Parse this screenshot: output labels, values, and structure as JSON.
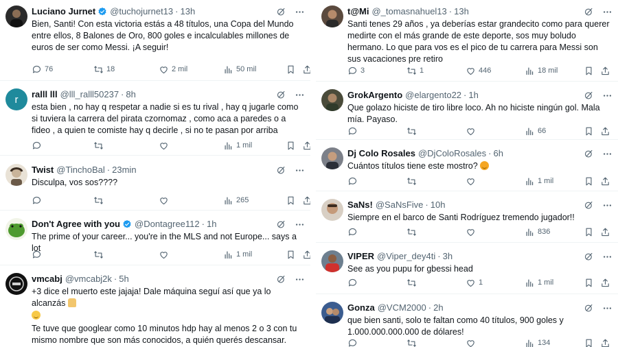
{
  "left": [
    {
      "name": "Luciano Jurnet",
      "verified": true,
      "handle": "@tuchojurnet13",
      "time": "13h",
      "text": "Bien, Santi! Con esta victoria estás a 48 títulos, una Copa del Mundo entre ellos, 8 Balones de Oro, 800 goles e incalculables millones de euros de ser como Messi. ¡A seguir!",
      "replies": "76",
      "retweets": "18",
      "likes": "2 mil",
      "views": "50 mil",
      "avatar_icon": "dark-portrait-avatar"
    },
    {
      "name": "ralll lll",
      "verified": false,
      "handle": "@lll_ralll50237",
      "time": "8h",
      "text": "esta bien , no hay q respetar a nadie si es tu rival , hay q jugarle como si tuviera la carrera del pirata czornomaz , como aca a paredes o a fideo , a quien te comiste hay q decirle , si no te pasan por arriba",
      "replies": "",
      "retweets": "",
      "likes": "",
      "views": "1 mil",
      "avatar_letter": "r"
    },
    {
      "name": "Twist",
      "verified": false,
      "handle": "@TinchoBal",
      "time": "23min",
      "text": "Disculpa, vos sos????",
      "replies": "",
      "retweets": "",
      "likes": "",
      "views": "265",
      "avatar_icon": "sketch-avatar"
    },
    {
      "name": "Don't Agree with you",
      "verified": true,
      "handle": "@Dontagree112",
      "time": "1h",
      "text": "The prime of your career... you're in the MLS and not Europe... says a lot",
      "replies": "",
      "retweets": "",
      "likes": "",
      "views": "1 mil",
      "avatar_icon": "green-frog-avatar"
    },
    {
      "name": "vmcabj",
      "verified": false,
      "handle": "@vmcabj2k",
      "time": "5h",
      "text_line1": "+3 dice el muerto este jajaja! Dale máquina seguí así que ya lo alcanzás",
      "text_line2": "Te tuve que googlear como 10 minutos hdp hay al menos 2 o 3 con tu mismo nombre que son más conocidos, a quién querés descansar.",
      "avatar_icon": "club-crest-avatar"
    }
  ],
  "right": [
    {
      "name": "t@Mi",
      "verified": false,
      "handle": "@_tomasnahuel13",
      "time": "13h",
      "text": "Santi tenes 29 años , ya deberías estar grandecito como para querer medirte con el más grande de este deporte, sos muy boludo hermano. Lo que para vos es el pico de tu carrera para Messi son sus vacaciones pre retiro",
      "replies": "3",
      "retweets": "1",
      "likes": "446",
      "views": "18 mil",
      "avatar_icon": "selfie-avatar"
    },
    {
      "name": "GrokArgento",
      "verified": false,
      "handle": "@elargento22",
      "time": "1h",
      "text": "Que golazo hiciste de tiro libre loco. Ah no hiciste ningún gol. Mala mía. Payaso.",
      "replies": "",
      "retweets": "",
      "likes": "",
      "views": "66",
      "avatar_icon": "portrait-avatar"
    },
    {
      "name": "Dj Colo Rosales",
      "verified": false,
      "handle": "@DjColoRosales",
      "time": "6h",
      "text": "Cuántos títulos tiene este mostro?",
      "replies": "",
      "retweets": "",
      "likes": "",
      "views": "1 mil",
      "avatar_icon": "dj-avatar"
    },
    {
      "name": "SaNs!",
      "verified": false,
      "handle": "@SaNsFive",
      "time": "10h",
      "text": "Siempre en el barco de Santi Rodríguez  tremendo jugador!!",
      "replies": "",
      "retweets": "",
      "likes": "",
      "views": "836",
      "avatar_icon": "face-avatar"
    },
    {
      "name": "VIPER",
      "verified": false,
      "handle": "@Viper_dey4ti",
      "time": "3h",
      "text": "See as you pupu for gbessi head",
      "replies": "",
      "retweets": "",
      "likes": "1",
      "views": "1 mil",
      "avatar_icon": "red-shirt-avatar"
    },
    {
      "name": "Gonza",
      "verified": false,
      "handle": "@VCM2000",
      "time": "2h",
      "text": "que bien santi, solo te faltan como 40 títulos, 900 goles y 1.000.000.000.000 de dólares!",
      "replies": "",
      "retweets": "",
      "likes": "",
      "views": "134",
      "avatar_icon": "team-avatar"
    }
  ],
  "colors": {
    "verified": "#1d9bf0",
    "muted": "#536471",
    "text": "#0f1419",
    "divider": "#eff3f4"
  },
  "icons": [
    "reply-icon",
    "retweet-icon",
    "like-icon",
    "views-icon",
    "bookmark-icon",
    "share-icon",
    "grok-icon",
    "more-icon",
    "verified-icon"
  ]
}
